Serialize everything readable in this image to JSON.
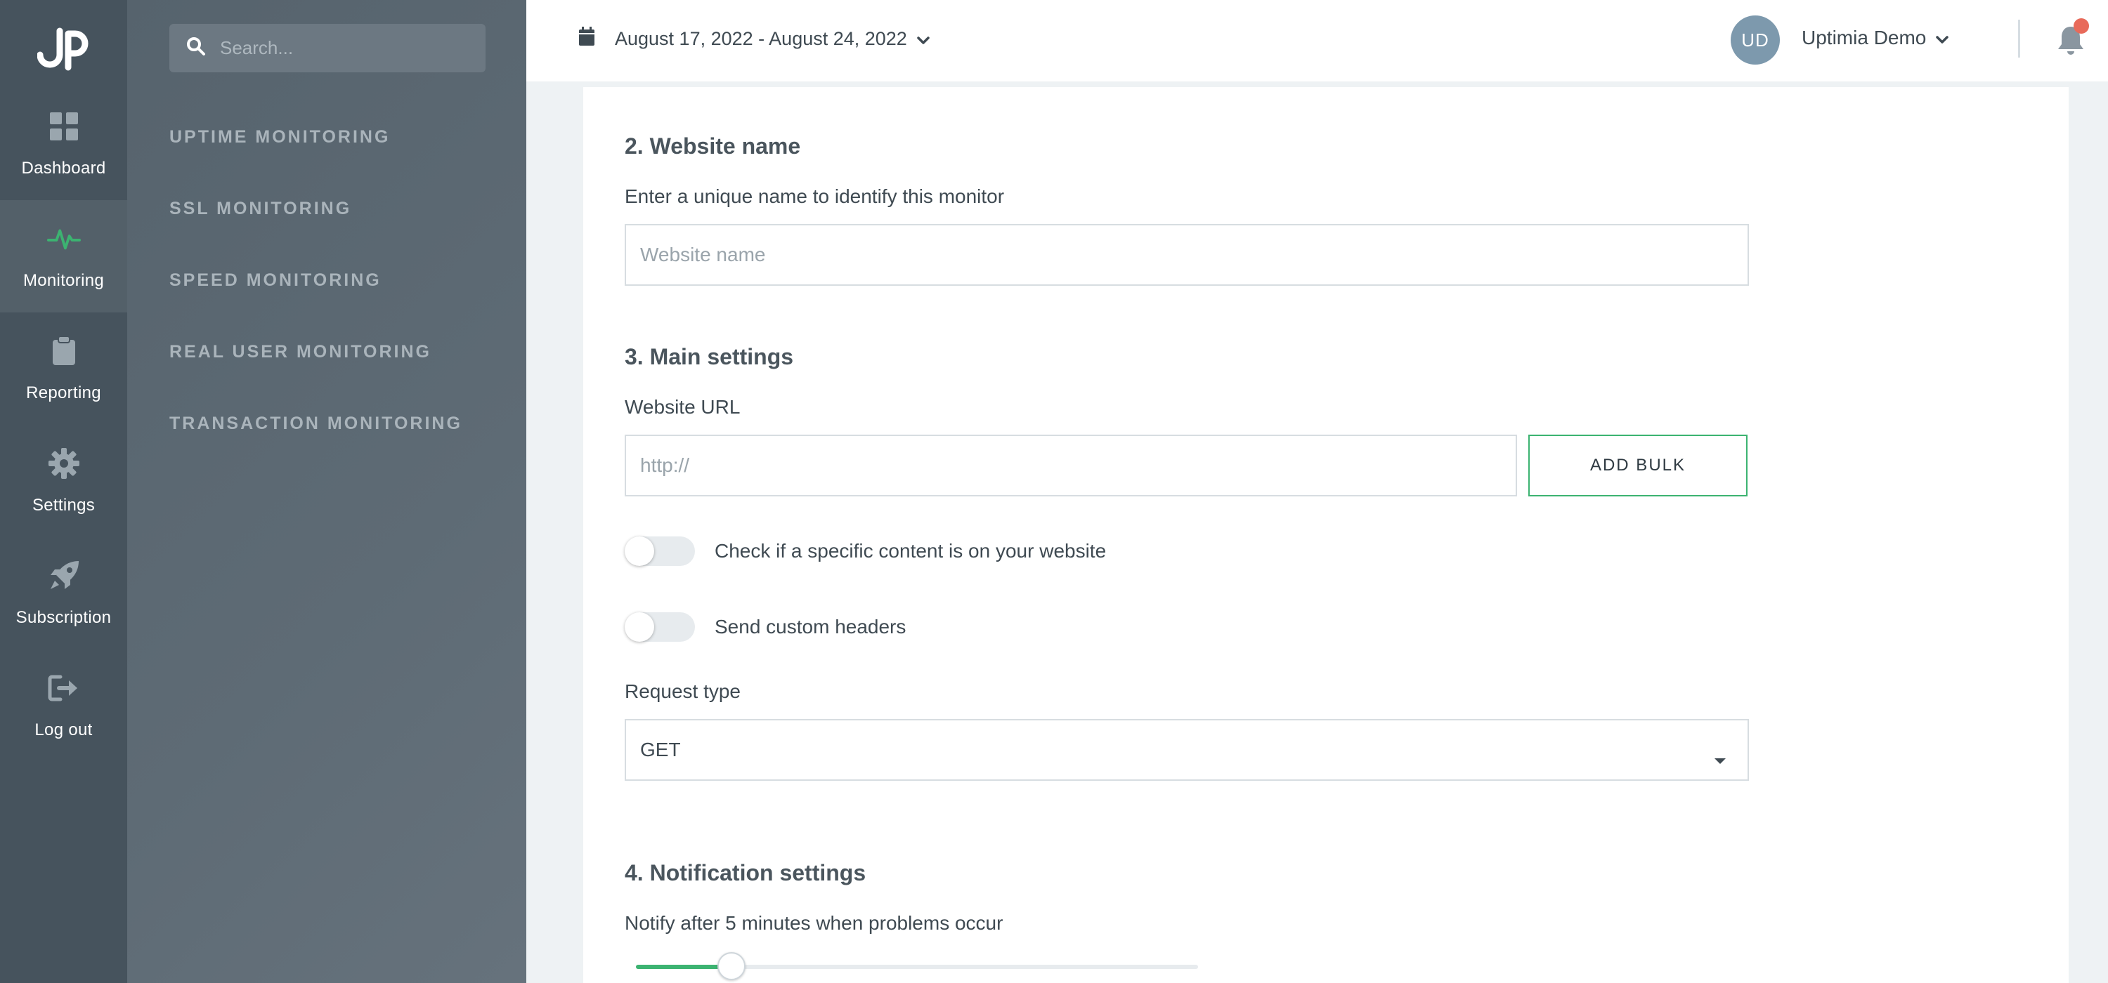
{
  "colors": {
    "rail_bg": "#46535d",
    "subnav_bg": "#5e6b75",
    "accent_green": "#3cb371",
    "avatar_bg": "#7d99ad",
    "notification_dot": "#e86a5a"
  },
  "rail": {
    "logo_icon": "uptimia-logo-icon",
    "items": [
      {
        "label": "Dashboard",
        "icon": "dashboard-grid-icon",
        "active": false
      },
      {
        "label": "Monitoring",
        "icon": "heartbeat-icon",
        "active": true
      },
      {
        "label": "Reporting",
        "icon": "clipboard-icon",
        "active": false
      },
      {
        "label": "Settings",
        "icon": "gear-icon",
        "active": false
      },
      {
        "label": "Subscription",
        "icon": "rocket-icon",
        "active": false
      },
      {
        "label": "Log out",
        "icon": "logout-icon",
        "active": false
      }
    ]
  },
  "subnav": {
    "search_placeholder": "Search...",
    "items": [
      {
        "label": "UPTIME MONITORING"
      },
      {
        "label": "SSL MONITORING"
      },
      {
        "label": "SPEED MONITORING"
      },
      {
        "label": "REAL USER MONITORING"
      },
      {
        "label": "TRANSACTION MONITORING"
      }
    ]
  },
  "header": {
    "date_range": "August 17, 2022 - August 24, 2022",
    "avatar_initials": "UD",
    "user_name": "Uptimia Demo"
  },
  "form": {
    "section_name": {
      "title": "2. Website name",
      "label": "Enter a unique name to identify this monitor",
      "placeholder": "Website name",
      "value": ""
    },
    "section_main": {
      "title": "3. Main settings",
      "url_label": "Website URL",
      "url_placeholder": "http://",
      "url_value": "",
      "add_bulk_label": "ADD BULK",
      "toggle_content_label": "Check if a specific content is on your website",
      "toggle_content_on": false,
      "toggle_headers_label": "Send custom headers",
      "toggle_headers_on": false,
      "request_type_label": "Request type",
      "request_type_value": "GET"
    },
    "section_notify": {
      "title": "4. Notification settings",
      "label": "Notify after 5 minutes when problems occur",
      "slider_fraction": 0.17
    }
  }
}
